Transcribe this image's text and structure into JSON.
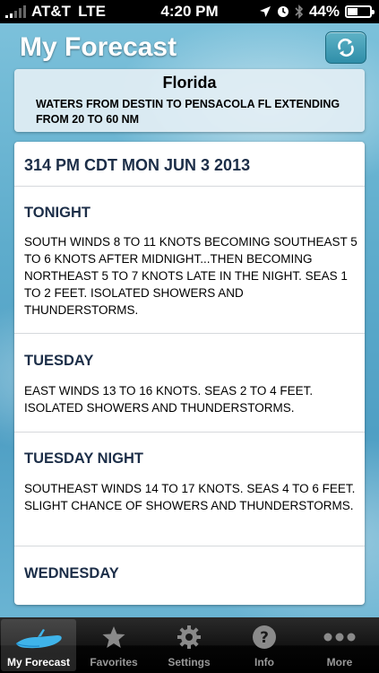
{
  "status_bar": {
    "carrier": "AT&T",
    "network": "LTE",
    "time": "4:20 PM",
    "battery": "44%",
    "battery_level": 0.44
  },
  "header": {
    "title": "My Forecast"
  },
  "location": {
    "name": "Florida",
    "description": "WATERS FROM DESTIN TO PENSACOLA FL EXTENDING FROM 20 TO 60 NM"
  },
  "forecast": {
    "issued": "314 PM CDT MON JUN 3 2013",
    "periods": [
      {
        "name": "TONIGHT",
        "text": "SOUTH WINDS 8 TO 11 KNOTS BECOMING SOUTHEAST 5 TO 6 KNOTS AFTER MIDNIGHT...THEN BECOMING NORTHEAST 5 TO 7 KNOTS LATE IN THE NIGHT. SEAS 1 TO 2 FEET. ISOLATED SHOWERS AND THUNDERSTORMS."
      },
      {
        "name": "TUESDAY",
        "text": "EAST WINDS 13 TO 16 KNOTS. SEAS 2 TO 4 FEET. ISOLATED SHOWERS AND THUNDERSTORMS."
      },
      {
        "name": "TUESDAY NIGHT",
        "text": "SOUTHEAST WINDS 14 TO 17 KNOTS. SEAS 4 TO 6 FEET. SLIGHT CHANCE OF SHOWERS AND THUNDERSTORMS."
      },
      {
        "name": "WEDNESDAY",
        "text": ""
      }
    ]
  },
  "tabs": [
    {
      "label": "My Forecast",
      "icon": "boat-icon",
      "active": true
    },
    {
      "label": "Favorites",
      "icon": "star-icon",
      "active": false
    },
    {
      "label": "Settings",
      "icon": "gear-icon",
      "active": false
    },
    {
      "label": "Info",
      "icon": "info-icon",
      "active": false
    },
    {
      "label": "More",
      "icon": "more-icon",
      "active": false
    }
  ],
  "colors": {
    "heading": "#1c2e48",
    "accent": "#2f8ea9",
    "tab_active": "#ffffff",
    "tab_inactive": "#999999"
  }
}
